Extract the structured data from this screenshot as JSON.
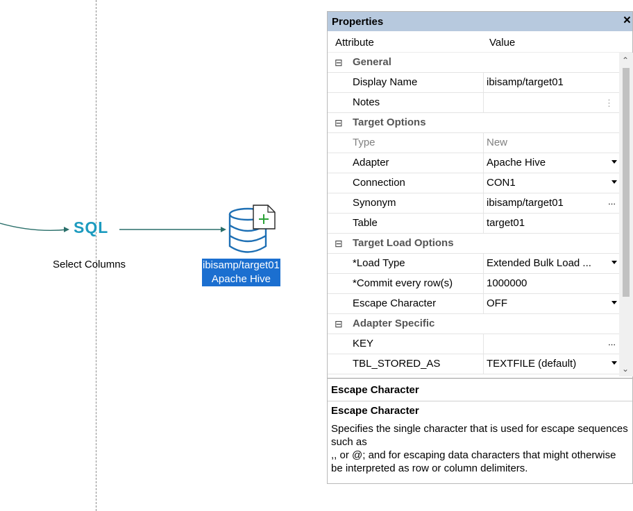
{
  "canvas": {
    "sql_node": {
      "icon_text": "SQL",
      "label": "Select Columns"
    },
    "target_node": {
      "label_line1": "ibisamp/target01",
      "label_line2": "Apache Hive"
    }
  },
  "properties": {
    "title": "Properties",
    "close": "×",
    "columns": {
      "attribute": "Attribute",
      "value": "Value"
    },
    "groups": {
      "general": {
        "label": "General",
        "toggle": "⊟",
        "display_name": {
          "name": "Display Name",
          "value": "ibisamp/target01"
        },
        "notes": {
          "name": "Notes",
          "value": ""
        }
      },
      "target_options": {
        "label": "Target Options",
        "toggle": "⊟",
        "type": {
          "name": "Type",
          "value": "New"
        },
        "adapter": {
          "name": "Adapter",
          "value": "Apache Hive"
        },
        "connection": {
          "name": "Connection",
          "value": "CON1"
        },
        "synonym": {
          "name": "Synonym",
          "value": "ibisamp/target01"
        },
        "table": {
          "name": "Table",
          "value": "target01"
        }
      },
      "target_load_options": {
        "label": "Target Load Options",
        "toggle": "⊟",
        "load_type": {
          "name": "*Load Type",
          "value": "Extended Bulk Load ..."
        },
        "commit": {
          "name": "*Commit every row(s)",
          "value": "1000000"
        },
        "escape": {
          "name": "Escape Character",
          "value": "OFF"
        }
      },
      "adapter_specific": {
        "label": "Adapter Specific",
        "toggle": "⊟",
        "key": {
          "name": "KEY",
          "value": ""
        },
        "tbl_stored_as": {
          "name": "TBL_STORED_AS",
          "value": "TEXTFILE (default)"
        }
      }
    },
    "ellipsis": "...",
    "description": {
      "heading": "Escape Character",
      "subheading": "Escape Character",
      "text": "Specifies the single character that is used for escape sequences such as\n,, or @; and for escaping data characters that might otherwise be interpreted as row or column delimiters."
    }
  }
}
